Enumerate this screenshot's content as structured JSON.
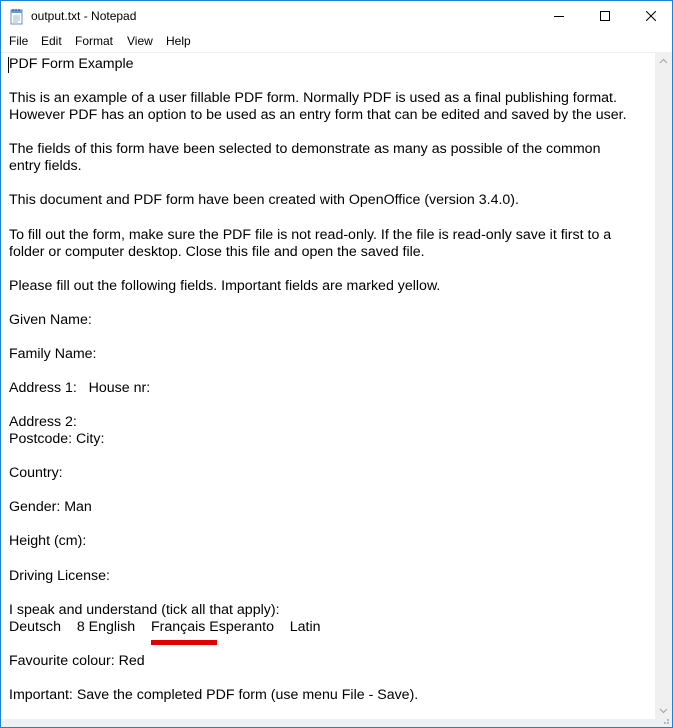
{
  "window": {
    "title": "output.txt - Notepad",
    "accent_color": "#1883d7"
  },
  "icons": {
    "app": "notepad-icon",
    "minimize": "minimize-icon",
    "maximize": "maximize-icon",
    "close": "close-icon",
    "scroll_up": "chevron-up-icon",
    "scroll_down": "chevron-down-icon",
    "grip": "resize-grip-icon"
  },
  "menu": {
    "items": [
      "File",
      "Edit",
      "Format",
      "View",
      "Help"
    ]
  },
  "document": {
    "lines": [
      "PDF Form Example",
      "",
      "This is an example of a user fillable PDF form. Normally PDF is used as a final publishing format.",
      "However PDF has an option to be used as an entry form that can be edited and saved by the user.",
      "",
      "The fields of this form have been selected to demonstrate as many as possible of the common",
      "entry fields.",
      "",
      "This document and PDF form have been created with OpenOffice (version 3.4.0).",
      "",
      "To fill out the form, make sure the PDF file is not read-only. If the file is read-only save it first to a",
      "folder or computer desktop. Close this file and open the saved file.",
      "",
      "Please fill out the following fields. Important fields are marked yellow.",
      "",
      "Given Name:",
      "",
      "Family Name:",
      "",
      "Address 1:   House nr:",
      "",
      "Address 2:",
      "Postcode: City:",
      "",
      "Country:",
      "",
      "Gender: Man",
      "",
      "Height (cm):",
      "",
      "Driving License:",
      "",
      "I speak and understand (tick all that apply):",
      "Deutsch    8 English    Français Esperanto    Latin",
      "",
      "Favourite colour: Red",
      "",
      "Important: Save the completed PDF form (use menu File - Save)."
    ],
    "highlight_color": "#e10000"
  }
}
